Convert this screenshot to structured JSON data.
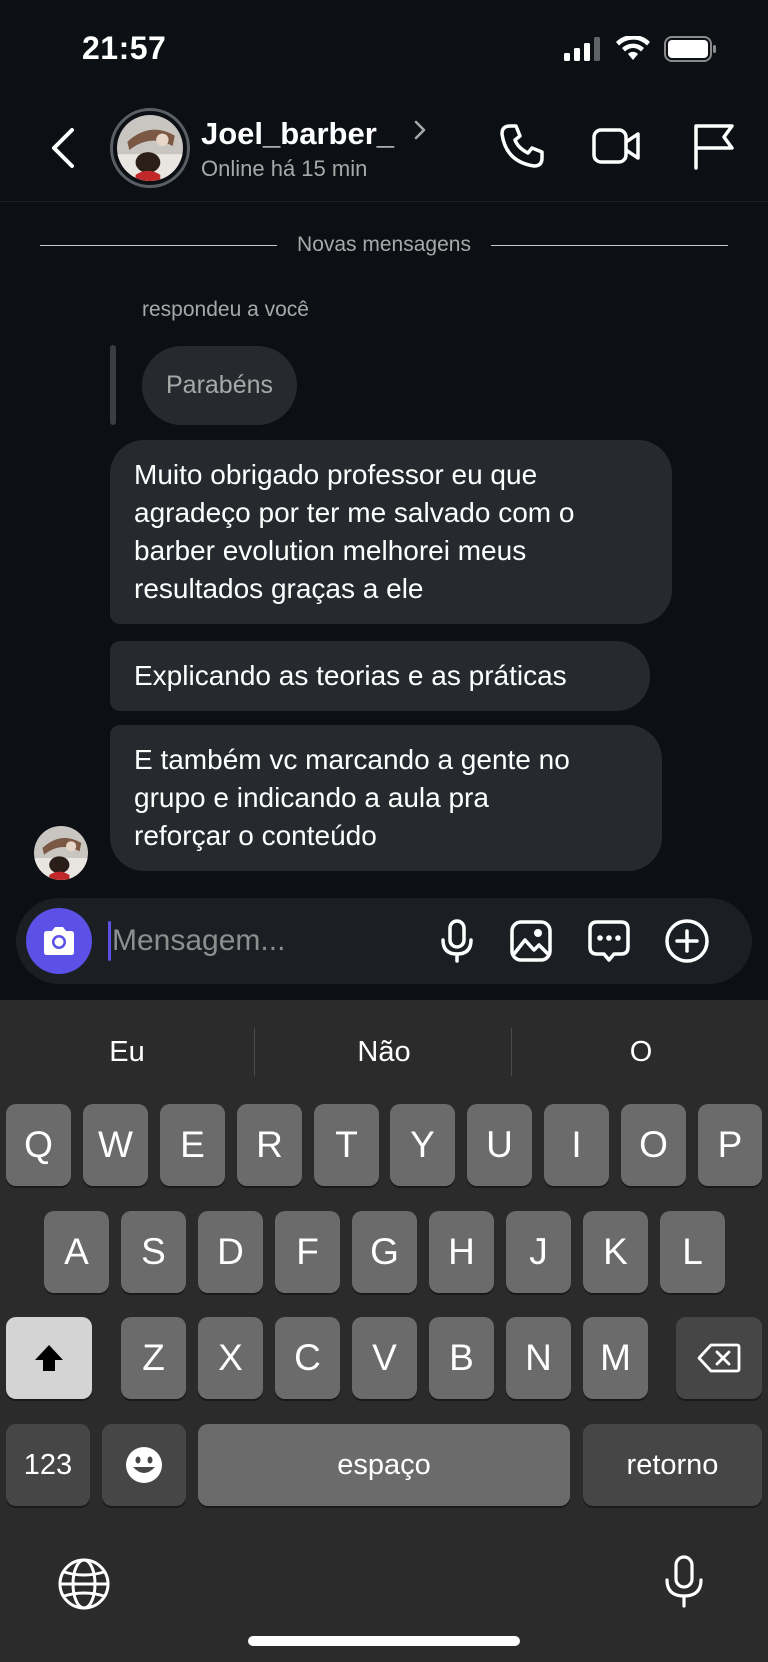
{
  "status_bar": {
    "time": "21:57",
    "battery_icon": "battery-icon",
    "wifi_icon": "wifi-icon",
    "signal_icon": "signal-icon"
  },
  "header": {
    "name": "Joel_barber_",
    "status": "Online há 15 min",
    "icons": [
      "back-icon",
      "chevron-right-icon",
      "phone-icon",
      "video-icon",
      "flag-icon"
    ]
  },
  "chat": {
    "divider": "Novas mensagens",
    "reply_caption": "respondeu a você",
    "reply_quote": "Parabéns",
    "messages": [
      {
        "lines": [
          "Muito obrigado professor eu que",
          "agradeço por ter me salvado com o",
          "barber evolution melhorei meus",
          "resultados graças a ele"
        ]
      },
      {
        "lines": [
          "Explicando as teorias e as práticas"
        ]
      },
      {
        "lines": [
          "E também vc marcando a gente no",
          "grupo e indicando a aula pra",
          "reforçar o conteúdo"
        ]
      }
    ]
  },
  "composer": {
    "placeholder": "Mensagem...",
    "icons": [
      "camera-icon",
      "microphone-icon",
      "gallery-icon",
      "sticker-icon",
      "plus-icon"
    ]
  },
  "keyboard": {
    "suggestions": [
      "Eu",
      "Não",
      "O"
    ],
    "row1": [
      "Q",
      "W",
      "E",
      "R",
      "T",
      "Y",
      "U",
      "I",
      "O",
      "P"
    ],
    "row2": [
      "A",
      "S",
      "D",
      "F",
      "G",
      "H",
      "J",
      "K",
      "L"
    ],
    "row3": [
      "Z",
      "X",
      "C",
      "V",
      "B",
      "N",
      "M"
    ],
    "numbers_label": "123",
    "space_label": "espaço",
    "return_label": "retorno",
    "icons": [
      "shift-icon",
      "backspace-icon",
      "emoji-icon",
      "globe-icon",
      "dictation-icon"
    ]
  },
  "colors": {
    "accent": "#5b51e6",
    "bubble": "#262a2f",
    "background": "#0c1014"
  }
}
